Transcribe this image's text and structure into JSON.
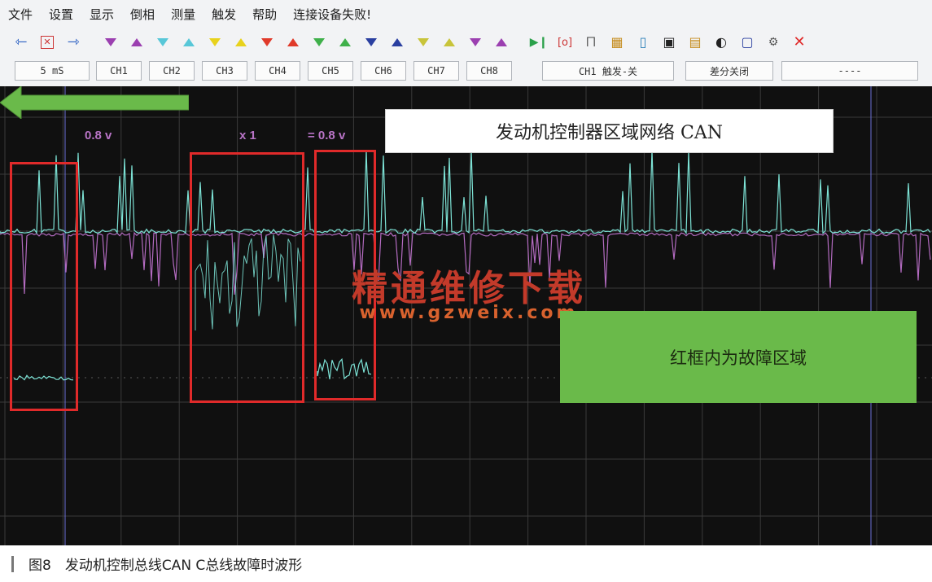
{
  "menu": [
    "文件",
    "设置",
    "显示",
    "倒相",
    "测量",
    "触发",
    "帮助",
    "连接设备失败!"
  ],
  "toolbar": {
    "icons": [
      "arrow-left-icon",
      "select-icon",
      "arrow-right-icon",
      "marker-down-icon",
      "marker-up-icon",
      "marker-down-icon",
      "marker-up-icon",
      "marker-down-icon",
      "marker-up-icon",
      "marker-down-icon",
      "marker-up-icon",
      "marker-down-icon",
      "marker-up-icon",
      "marker-down-icon",
      "marker-up-icon",
      "marker-down-icon",
      "marker-up-icon",
      "marker-down-icon",
      "marker-up-icon",
      "run-stop-icon",
      "cursor-icon",
      "pulse-icon",
      "grid-icon",
      "screen-icon",
      "save-icon",
      "open-icon",
      "contrast-icon",
      "window-icon",
      "settings-icon",
      "close-icon"
    ]
  },
  "status": {
    "timebase": "5 mS",
    "channels": [
      "CH1",
      "CH2",
      "CH3",
      "CH4",
      "CH5",
      "CH6",
      "CH7",
      "CH8"
    ],
    "trigger": "CH1 触发-关",
    "differential": "差分关闭",
    "extra": "----"
  },
  "scope": {
    "scale_left": "0.8 v",
    "scale_mid": "x 1",
    "scale_right": "= 0.8 v",
    "title": "发动机控制器区域网络 CAN",
    "callout": "红框内为故障区域",
    "watermark": "精通维修下载",
    "watermark_url": "www.gzweix.com"
  },
  "colors": {
    "trace_cyan": "#7de3d6",
    "trace_magenta": "#b36bc0",
    "highlight": "#e02a2a",
    "callout_green": "#6aba4a"
  },
  "caption": "图8　发动机控制总线CAN  C总线故障时波形"
}
